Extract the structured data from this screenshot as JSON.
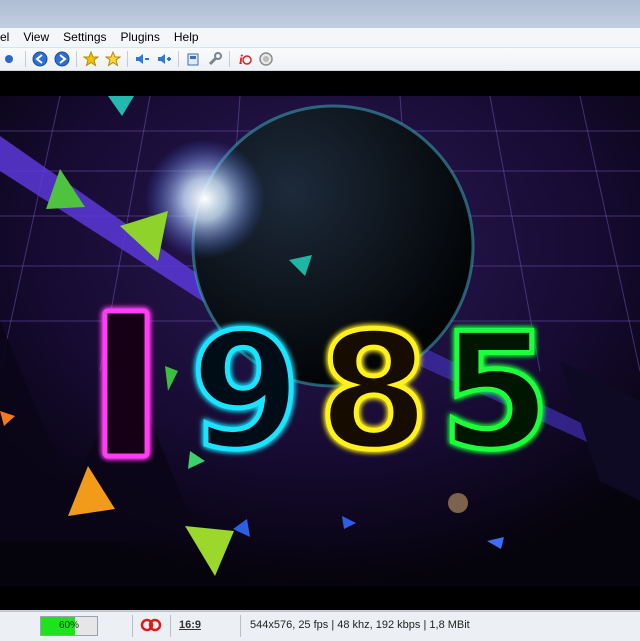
{
  "menu": [
    "el",
    "View",
    "Settings",
    "Plugins",
    "Help"
  ],
  "toolbar": {
    "icons": [
      "blue-dot-icon",
      "back-icon",
      "forward-icon",
      "favorite-star-icon",
      "add-favorite-icon",
      "volume-down-icon",
      "volume-up-icon",
      "snapshot-icon",
      "settings-wrench-icon",
      "info-icon",
      "stop-icon"
    ]
  },
  "video": {
    "overlay_text": "1985"
  },
  "status": {
    "progress_label": "60%",
    "progress_fraction": 0.6,
    "aspect": "16:9",
    "info": "544x576, 25 fps | 48 khz, 192 kbps | 1,8 MBit"
  }
}
